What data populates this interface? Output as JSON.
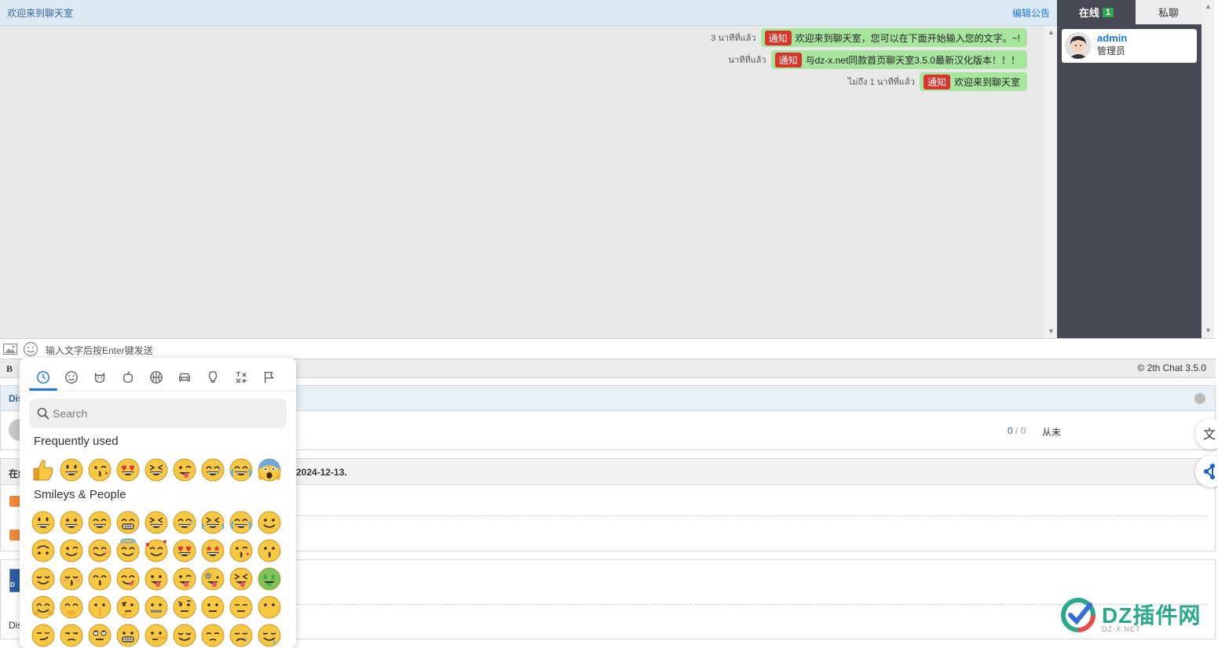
{
  "chat": {
    "title": "欢迎来到聊天室",
    "edit_notice": "编辑公告",
    "messages": [
      {
        "time": "3 นาทีที่แล้ว",
        "tag": "通知",
        "text": "欢迎来到聊天室，您可以在下面开始输入您的文字。~!"
      },
      {
        "time": "นาทีที่แล้ว",
        "tag": "通知",
        "text": "与dz-x.net同款首页聊天室3.5.0最新汉化版本！！！"
      },
      {
        "time": "ไม่ถึง 1 นาทีที่แล้ว",
        "tag": "通知",
        "text": "欢迎来到聊天室"
      }
    ],
    "input_placeholder": "输入文字后按Enter键发送",
    "bold_label": "B",
    "brand": "© 2th Chat 3.5.0"
  },
  "sidebar": {
    "tab_online": "在线",
    "online_count": "1",
    "tab_private": "私聊",
    "users": [
      {
        "name": "admin",
        "role": "管理员"
      }
    ]
  },
  "page": {
    "sec1_label": "Dis",
    "sec1_count_a": "0",
    "sec1_count_sep": " / ",
    "sec1_count_b": "0",
    "sec1_never": "从未",
    "sec2_label": "在线",
    "sec2_date": "2024-12-13.",
    "sec3_label": "Dis",
    "thumb_text": "D"
  },
  "picker": {
    "search_placeholder": "Search",
    "frequently_used": "Frequently used",
    "smileys_people": "Smileys & People",
    "categories": [
      "recent-icon",
      "smiley-icon",
      "animal-icon",
      "food-icon",
      "activity-icon",
      "travel-icon",
      "objects-icon",
      "symbols-icon",
      "flags-icon"
    ]
  },
  "watermark": {
    "main": "DZ插件网",
    "sub": "DZ-X.NET"
  },
  "colors": {
    "accent": "#1a73e8",
    "bubble": "#a8e6a0",
    "tag": "#d9342b",
    "sidebar": "#474a54",
    "online_badge": "#33a852"
  }
}
